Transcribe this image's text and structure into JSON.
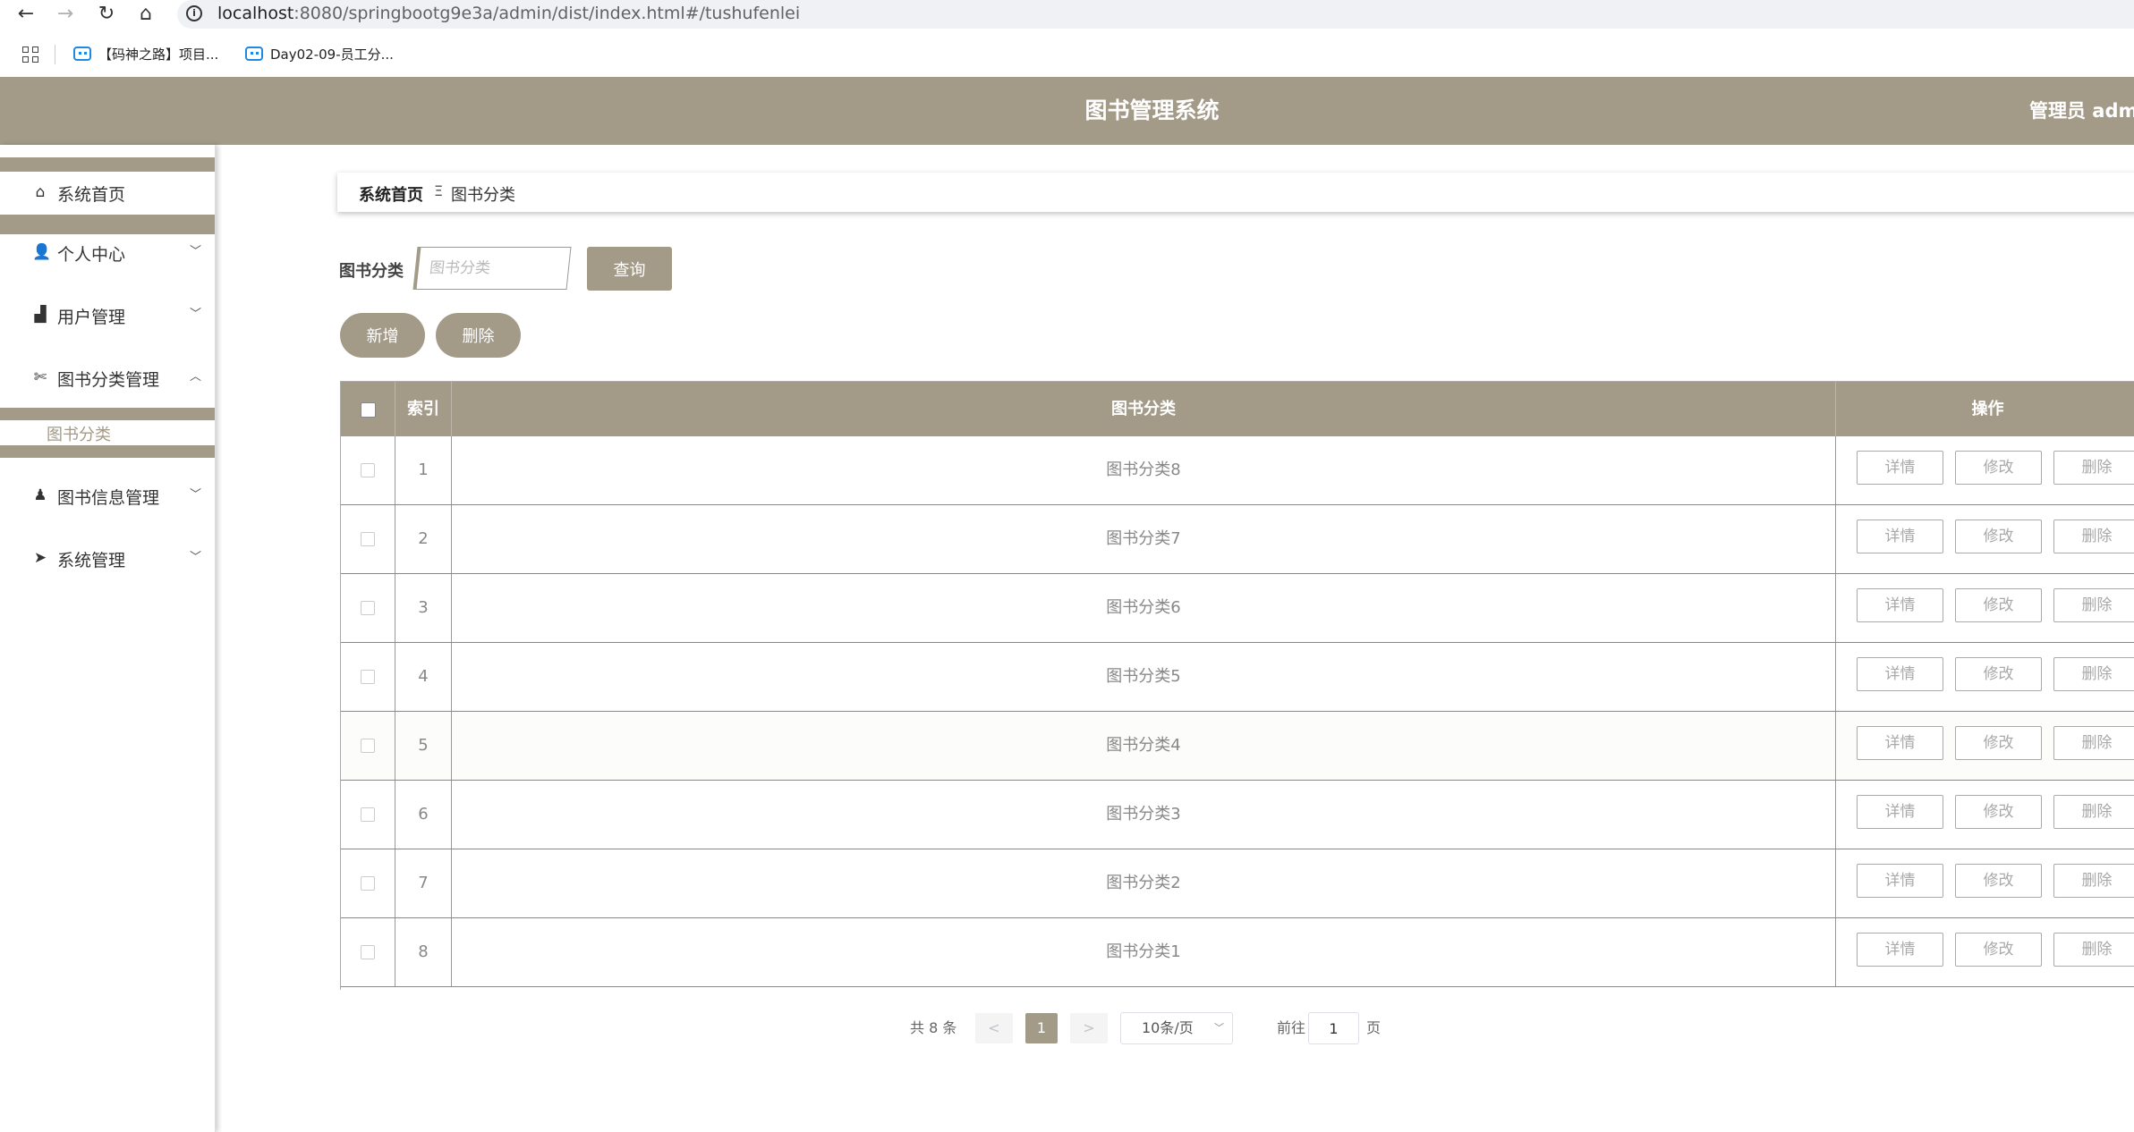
{
  "browser": {
    "url_host": "localhost",
    "url_rest": ":8080/springbootg9e3a/admin/dist/index.html#/tushufenlei",
    "bookmarks": [
      "【码神之路】项目...",
      "Day02-09-员工分..."
    ]
  },
  "header": {
    "title": "图书管理系统",
    "admin": "管理员 admi"
  },
  "sidebar": {
    "items": [
      {
        "label": "系统首页",
        "icon": "home-icon"
      },
      {
        "label": "个人中心",
        "icon": "user-icon"
      },
      {
        "label": "用户管理",
        "icon": "paint-roller-icon"
      },
      {
        "label": "图书分类管理",
        "icon": "ticket-icon",
        "expanded": true,
        "children": [
          "图书分类"
        ]
      },
      {
        "label": "图书信息管理",
        "icon": "person-icon"
      },
      {
        "label": "系统管理",
        "icon": "paper-plane-icon"
      }
    ]
  },
  "breadcrumb": {
    "home": "系统首页",
    "separator": "Ξ",
    "current": "图书分类"
  },
  "search": {
    "label": "图书分类",
    "placeholder": "图书分类",
    "button": "查询"
  },
  "actions": {
    "add": "新增",
    "delete": "删除"
  },
  "table": {
    "headers": {
      "index": "索引",
      "category": "图书分类",
      "ops": "操作"
    },
    "op_labels": {
      "detail": "详情",
      "edit": "修改",
      "delete": "删除"
    },
    "rows": [
      {
        "index": "1",
        "category": "图书分类8"
      },
      {
        "index": "2",
        "category": "图书分类7"
      },
      {
        "index": "3",
        "category": "图书分类6"
      },
      {
        "index": "4",
        "category": "图书分类5"
      },
      {
        "index": "5",
        "category": "图书分类4"
      },
      {
        "index": "6",
        "category": "图书分类3"
      },
      {
        "index": "7",
        "category": "图书分类2"
      },
      {
        "index": "8",
        "category": "图书分类1"
      }
    ]
  },
  "pagination": {
    "total": "共 8 条",
    "prev": "<",
    "current_page": "1",
    "next": ">",
    "page_size": "10条/页",
    "goto_label": "前往",
    "goto_value": "1",
    "page_suffix": "页"
  },
  "colors": {
    "accent": "#a39a88"
  }
}
